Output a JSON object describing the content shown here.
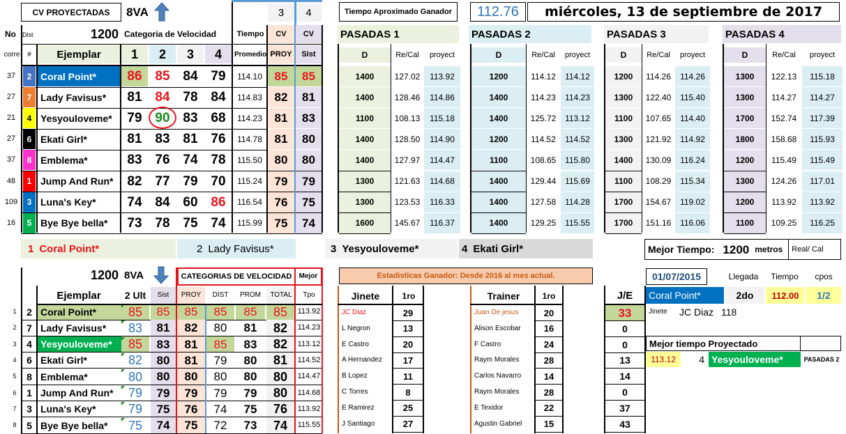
{
  "top": {
    "title": "CV PROYECTADAS",
    "race": "8VA",
    "col3": "3",
    "col4": "4",
    "tiempo_label": "Tiempo Aproximado Ganador",
    "tiempo_val": "112.76",
    "date": "miércoles, 13 de septiembre de 2017"
  },
  "hdr": {
    "no": "No",
    "dist_small": "Dist",
    "dist": "1200",
    "cat": "Categoria de Velocidad",
    "tiempo": "Tiempo",
    "cv1": "CV",
    "cv2": "CV",
    "p1": "PASADAS 1",
    "p2": "PASADAS 2",
    "p3": "PASADAS 3",
    "p4": "PASADAS 4",
    "corre": "corre",
    "num": "#",
    "ejemplar": "Ejemplar",
    "c1": "1",
    "c2": "2",
    "c3": "3",
    "c4": "4",
    "promedio": "Promedio",
    "proy": "PROY",
    "sist": "Sist",
    "d": "D",
    "recal": "Re/Cal",
    "proyect": "proyect"
  },
  "runners": [
    {
      "corre": "37",
      "num": "2",
      "numbg": "#4472c4",
      "name": "Coral Point*",
      "cv": [
        "86",
        "85",
        "84",
        "79"
      ],
      "prom": "114.10",
      "proy": "85",
      "sist": "85",
      "pas": [
        [
          "1400",
          "127.02",
          "113.92"
        ],
        [
          "1200",
          "114.12",
          "114.12"
        ],
        [
          "1200",
          "114.26",
          "114.26"
        ],
        [
          "1300",
          "122.13",
          "115.18"
        ]
      ]
    },
    {
      "corre": "27",
      "num": "7",
      "numbg": "#ed7d31",
      "name": "Lady Favisus*",
      "cv": [
        "81",
        "84",
        "78",
        "84"
      ],
      "prom": "114.83",
      "proy": "82",
      "sist": "81",
      "pas": [
        [
          "1400",
          "128.46",
          "114.86"
        ],
        [
          "1400",
          "114.23",
          "114.23"
        ],
        [
          "1300",
          "122.40",
          "115.40"
        ],
        [
          "1300",
          "114.27",
          "114.27"
        ]
      ]
    },
    {
      "corre": "21",
      "num": "4",
      "numbg": "#ffff00",
      "name": "Yesyouloveme*",
      "cv": [
        "79",
        "90",
        "83",
        "68"
      ],
      "prom": "114.23",
      "proy": "81",
      "sist": "83",
      "pas": [
        [
          "1100",
          "108.13",
          "115.18"
        ],
        [
          "1400",
          "125.72",
          "113.12"
        ],
        [
          "1100",
          "107.65",
          "114.40"
        ],
        [
          "1700",
          "152.74",
          "117.39"
        ]
      ]
    },
    {
      "corre": "27",
      "num": "6",
      "numbg": "#000000",
      "name": "Ekati Girl*",
      "cv": [
        "81",
        "83",
        "81",
        "76"
      ],
      "prom": "114.78",
      "proy": "81",
      "sist": "80",
      "pas": [
        [
          "1400",
          "128.50",
          "114.90"
        ],
        [
          "1200",
          "114.52",
          "114.52"
        ],
        [
          "1300",
          "121.92",
          "114.92"
        ],
        [
          "1800",
          "158.68",
          "115.93"
        ]
      ]
    },
    {
      "corre": "37",
      "num": "8",
      "numbg": "#ff33cc",
      "name": "Emblema*",
      "cv": [
        "83",
        "76",
        "74",
        "78"
      ],
      "prom": "115.50",
      "proy": "80",
      "sist": "80",
      "pas": [
        [
          "1400",
          "127.97",
          "114.47"
        ],
        [
          "1100",
          "108.65",
          "115.80"
        ],
        [
          "1400",
          "130.09",
          "116.24"
        ],
        [
          "1200",
          "115.49",
          "115.49"
        ]
      ]
    },
    {
      "corre": "48",
      "num": "1",
      "numbg": "#ff0000",
      "name": "Jump And Run*",
      "cv": [
        "82",
        "77",
        "79",
        "70"
      ],
      "prom": "115.24",
      "proy": "79",
      "sist": "79",
      "pas": [
        [
          "1300",
          "121.63",
          "114.68"
        ],
        [
          "1400",
          "129.44",
          "115.69"
        ],
        [
          "1100",
          "108.29",
          "115.34"
        ],
        [
          "1300",
          "124.26",
          "117.01"
        ]
      ]
    },
    {
      "corre": "109",
      "num": "3",
      "numbg": "#0070c0",
      "name": "Luna's Key*",
      "cv": [
        "74",
        "84",
        "60",
        "86"
      ],
      "prom": "116.54",
      "proy": "76",
      "sist": "75",
      "pas": [
        [
          "1300",
          "123.53",
          "116.33"
        ],
        [
          "1400",
          "127.58",
          "114.28"
        ],
        [
          "1700",
          "154.67",
          "119.02"
        ],
        [
          "1200",
          "113.92",
          "113.92"
        ]
      ]
    },
    {
      "corre": "16",
      "num": "5",
      "numbg": "#00b050",
      "name": "Bye Bye bella*",
      "cv": [
        "73",
        "78",
        "75",
        "74"
      ],
      "prom": "115.99",
      "proy": "75",
      "sist": "74",
      "pas": [
        [
          "1600",
          "145.67",
          "116.37"
        ],
        [
          "1400",
          "129.25",
          "115.55"
        ],
        [
          "1700",
          "151.16",
          "116.06"
        ],
        [
          "1100",
          "109.25",
          "116.25"
        ]
      ]
    }
  ],
  "top4": {
    "t1n": "1",
    "t1": "Coral Point*",
    "t2n": "2",
    "t2": "Lady Favisus*",
    "t3n": "3",
    "t3": "Yesyouloveme*",
    "t4n": "4",
    "t4": "Ekati Girl*"
  },
  "mejor": {
    "label": "Mejor Tiempo:",
    "dist": "1200",
    "metros": "metros",
    "realcal": "Real/ Cal"
  },
  "bottom": {
    "dist": "1200",
    "race": "8VA",
    "catlabel": "CATEGORIAS DE VELOCIDAD",
    "mejor": "Mejor",
    "tpo": "Tpo",
    "ejemplar": "Ejemplar",
    "ult": "2 Ult",
    "sist": "Sist",
    "proy": "PROY",
    "distc": "DIST",
    "prom": "PROM",
    "total": "TOTAL"
  },
  "cv_rows": [
    {
      "i": "1",
      "num": "2",
      "name": "Coral Point*",
      "ult": "85",
      "sist": "85",
      "proy": "85",
      "dist": "85",
      "prom": "85",
      "total": "85",
      "tpo": "113.92"
    },
    {
      "i": "2",
      "num": "7",
      "name": "Lady Favisus*",
      "ult": "83",
      "sist": "81",
      "proy": "82",
      "dist": "80",
      "prom": "81",
      "total": "82",
      "tpo": "114.23"
    },
    {
      "i": "3",
      "num": "4",
      "name": "Yesyouloveme*",
      "ult": "85",
      "sist": "83",
      "proy": "81",
      "dist": "85",
      "prom": "83",
      "total": "82",
      "tpo": "113.12"
    },
    {
      "i": "4",
      "num": "6",
      "name": "Ekati Girl*",
      "ult": "82",
      "sist": "80",
      "proy": "81",
      "dist": "79",
      "prom": "80",
      "total": "81",
      "tpo": "114.52"
    },
    {
      "i": "5",
      "num": "8",
      "name": "Emblema*",
      "ult": "80",
      "sist": "80",
      "proy": "80",
      "dist": "80",
      "prom": "80",
      "total": "80",
      "tpo": "114.47"
    },
    {
      "i": "6",
      "num": "1",
      "name": "Jump And Run*",
      "ult": "79",
      "sist": "79",
      "proy": "79",
      "dist": "79",
      "prom": "79",
      "total": "80",
      "tpo": "114.68"
    },
    {
      "i": "7",
      "num": "3",
      "name": "Luna's Key*",
      "ult": "79",
      "sist": "75",
      "proy": "76",
      "dist": "74",
      "prom": "75",
      "total": "76",
      "tpo": "113.92"
    },
    {
      "i": "8",
      "num": "5",
      "name": "Bye Bye bella*",
      "ult": "75",
      "sist": "74",
      "proy": "75",
      "dist": "72",
      "prom": "73",
      "total": "74",
      "tpo": "115.55"
    }
  ],
  "stats": {
    "title": "Estadisticas  Ganador: Desde 2016 al mes actual.",
    "jinete": "Jinete",
    "trainer": "Trainer",
    "first": "1ro",
    "first2": "1ro"
  },
  "jockeys": [
    [
      "JC Diaz",
      "29"
    ],
    [
      "L Negron",
      "13"
    ],
    [
      "E Castro",
      "20"
    ],
    [
      "A Hernandez",
      "17"
    ],
    [
      "B Lopez",
      "11"
    ],
    [
      "C Torres",
      "8"
    ],
    [
      "E Ramirez",
      "25"
    ],
    [
      "J Santiago",
      "27"
    ]
  ],
  "trainers": [
    [
      "Juan De jesus",
      "20"
    ],
    [
      "Alison Escobar",
      "16"
    ],
    [
      "F Castro",
      "24"
    ],
    [
      "Raym Morales",
      "28"
    ],
    [
      "Carlos Navarro",
      "14"
    ],
    [
      "Raym Morales",
      "28"
    ],
    [
      "E Texidor",
      "22"
    ],
    [
      "Agustin Gabriel",
      "15"
    ]
  ],
  "je": {
    "label": "J/E",
    "vals": [
      "33",
      "0",
      "0",
      "13",
      "14",
      "0",
      "37",
      "43"
    ]
  },
  "info": {
    "date": "01/07/2015",
    "llegada": "Llegada",
    "tiempo": "Tiempo",
    "cpos": "cpos",
    "horse": "Coral Point*",
    "place": "2do",
    "time": "112.00",
    "cposv": "1/2",
    "jinete_l": "Jinete",
    "jinete": "JC Diaz",
    "peso": "118"
  },
  "mtp": {
    "label": "Mejor tiempo Proyectado",
    "val": "113.12",
    "num": "4",
    "horse": "Yesyouloveme*",
    "pas": "PASADAS 2"
  }
}
